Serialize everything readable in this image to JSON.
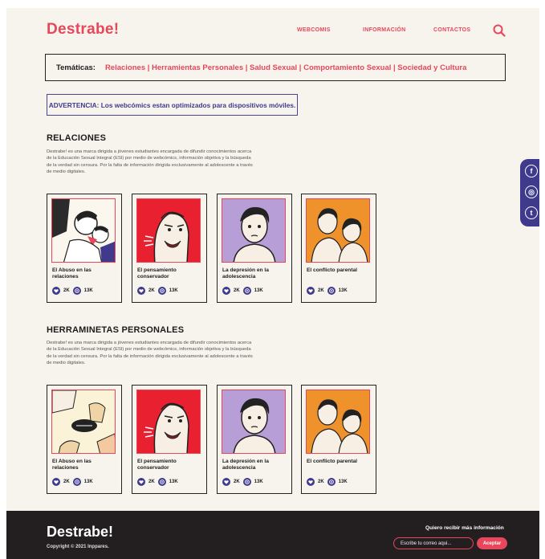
{
  "header": {
    "logo": "Destrabe!",
    "nav": [
      "WEBCOMIS",
      "INFORMACIÓN",
      "CONTACTOS"
    ]
  },
  "topics": {
    "label": "Temáticas:",
    "links": "Relaciones | Herramientas Personales | Salud Sexual | Comportamiento Sexual | Sociedad y Cultura"
  },
  "warning": "ADVERTENCIA: Los webcómics estan optimizados para dispositivos móviles.",
  "sections": [
    {
      "title": "RELACIONES",
      "description": "Destrabe! es una marca dirigida a jóvenes estudiantes encargada de difundir conocimientos acerca de la Educación Sexual Integral (ESI) por medio de webcómics, información objetiva y la búsqueda de la verdad sin censura. Por la falta de información dirigida exclusivamente al adolescente a través de medio digitales.",
      "cards": [
        {
          "title": "El Abuso en las relaciones",
          "likes": "2K",
          "views": "13K"
        },
        {
          "title": "El pensamiento conservador",
          "likes": "2K",
          "views": "13K"
        },
        {
          "title": "La depresión en la adolescencia",
          "likes": "2K",
          "views": "13K"
        },
        {
          "title": "El conflicto parental",
          "likes": "2K",
          "views": "13K"
        }
      ]
    },
    {
      "title": "HERRAMINETAS PERSONALES",
      "description": "Destrabe! es una marca dirigida a jóvenes estudiantes encargada de difundir conocimientos acerca de la Educación Sexual Integral (ESI) por medio de webcómics, información objetiva y la búsqueda de la verdad sin censura. Por la falta de información dirigida exclusivamente al adolescente a través de medio digitales.",
      "cards": [
        {
          "title": "El Abuso en las relaciones",
          "likes": "2K",
          "views": "13K"
        },
        {
          "title": "El pensamiento conservador",
          "likes": "2K",
          "views": "13K"
        },
        {
          "title": "La depresión en la adolescencia",
          "likes": "2K",
          "views": "13K"
        },
        {
          "title": "El conflicto parental",
          "likes": "2K",
          "views": "13K"
        }
      ]
    }
  ],
  "social": [
    {
      "icon": "facebook-icon",
      "glyph": "f"
    },
    {
      "icon": "instagram-icon",
      "glyph": "◎"
    },
    {
      "icon": "tumblr-icon",
      "glyph": "t"
    }
  ],
  "footer": {
    "logo": "Destrabe!",
    "copyright": "Copyright © 2021 Inppares.",
    "cta": "Quiero recibir más información",
    "email_placeholder": "Escribe tu correo aqui...",
    "submit": "Aceptar"
  },
  "colors": {
    "accent": "#e8465a",
    "purple": "#3f3a8c",
    "background": "#f7f4ee",
    "footer": "#231f20"
  }
}
